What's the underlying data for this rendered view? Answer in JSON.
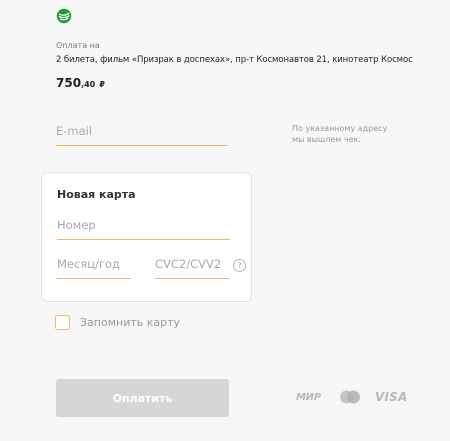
{
  "brand": {
    "logo_icon": "sberbank-logo-icon",
    "color": "#21a038"
  },
  "order": {
    "pay_for_label": "Оплата на",
    "description": "2 билета, фильм «Призрак в доспехах», пр-т Космонавтов 21, кинотеатр Космос",
    "amount_main": "750",
    "amount_fraction": ",40",
    "currency": "₽"
  },
  "email": {
    "placeholder": "E-mail",
    "hint_line1": "По указанному адресу",
    "hint_line2": "мы вышлем чек."
  },
  "card": {
    "title": "Новая карта",
    "number_placeholder": "Номер",
    "expiry_placeholder": "Месяц/год",
    "cvc_placeholder": "CVC2/CVV2",
    "help_symbol": "?"
  },
  "remember": {
    "label": "Запомнить карту",
    "checked": false
  },
  "pay_button": {
    "label": "Оплатить",
    "enabled": false
  },
  "payment_logos": {
    "mir": "МИР",
    "mastercard_icon": "mastercard-icon",
    "visa": "VISA"
  },
  "colors": {
    "accent": "#f2b56b",
    "button_disabled": "#d6d6d6",
    "muted": "#a9a9a9"
  }
}
